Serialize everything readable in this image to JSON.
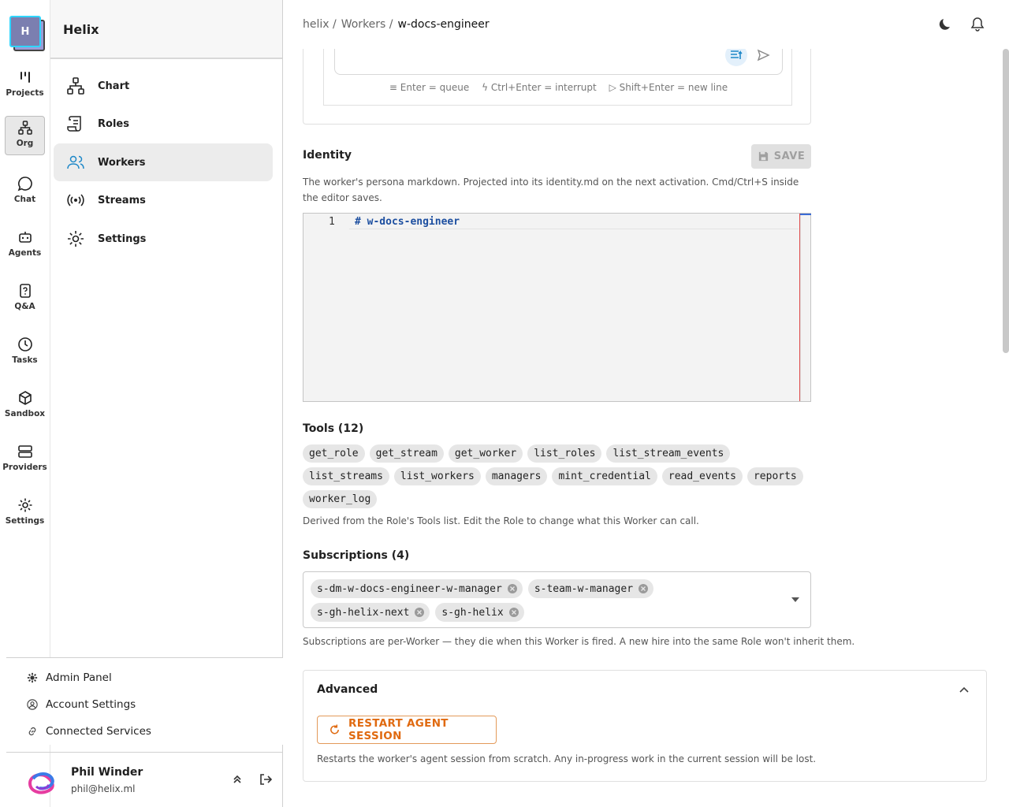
{
  "org": {
    "initial": "H",
    "name": "Helix"
  },
  "rail": {
    "items": [
      {
        "label": "Projects",
        "icon": "projects-icon"
      },
      {
        "label": "Org",
        "icon": "org-icon"
      },
      {
        "label": "Chat",
        "icon": "chat-icon"
      },
      {
        "label": "Agents",
        "icon": "agents-icon"
      },
      {
        "label": "Q&A",
        "icon": "qa-icon"
      },
      {
        "label": "Tasks",
        "icon": "tasks-icon"
      },
      {
        "label": "Sandbox",
        "icon": "sandbox-icon"
      },
      {
        "label": "Providers",
        "icon": "providers-icon"
      },
      {
        "label": "Settings",
        "icon": "settings-icon"
      }
    ],
    "active": "Org"
  },
  "sidebar": {
    "items": [
      {
        "label": "Chart",
        "icon": "chart-icon"
      },
      {
        "label": "Roles",
        "icon": "roles-icon"
      },
      {
        "label": "Workers",
        "icon": "workers-icon"
      },
      {
        "label": "Streams",
        "icon": "streams-icon"
      },
      {
        "label": "Settings",
        "icon": "settings-icon"
      }
    ],
    "active": "Workers",
    "footer_links": [
      "Admin Panel",
      "Account Settings",
      "Connected Services"
    ]
  },
  "user": {
    "name": "Phil Winder",
    "email": "phil@helix.ml"
  },
  "breadcrumb": {
    "root": "helix /",
    "section": "Workers /",
    "current": "w-docs-engineer"
  },
  "chat": {
    "hint_queue": "Enter = queue",
    "hint_interrupt": "Ctrl+Enter = interrupt",
    "hint_newline": "Shift+Enter = new line"
  },
  "identity": {
    "title": "Identity",
    "save_label": "SAVE",
    "description": "The worker's persona markdown. Projected into its identity.md on the next activation. Cmd/Ctrl+S inside the editor saves.",
    "line_number": "1",
    "content": "# w-docs-engineer"
  },
  "tools": {
    "title": "Tools (12)",
    "items": [
      "get_role",
      "get_stream",
      "get_worker",
      "list_roles",
      "list_stream_events",
      "list_streams",
      "list_workers",
      "managers",
      "mint_credential",
      "read_events",
      "reports",
      "worker_log"
    ],
    "description": "Derived from the Role's Tools list. Edit the Role to change what this Worker can call."
  },
  "subscriptions": {
    "title": "Subscriptions (4)",
    "items": [
      "s-dm-w-docs-engineer-w-manager",
      "s-team-w-manager",
      "s-gh-helix-next",
      "s-gh-helix"
    ],
    "description": "Subscriptions are per-Worker — they die when this Worker is fired. A new hire into the same Role won't inherit them."
  },
  "advanced": {
    "title": "Advanced",
    "restart_label": "RESTART AGENT SESSION",
    "description": "Restarts the worker's agent session from scratch. Any in-progress work in the current session will be lost."
  },
  "colors": {
    "accent": "#2fd6ff",
    "warning": "#e06a10",
    "code": "#1d4fa0"
  }
}
